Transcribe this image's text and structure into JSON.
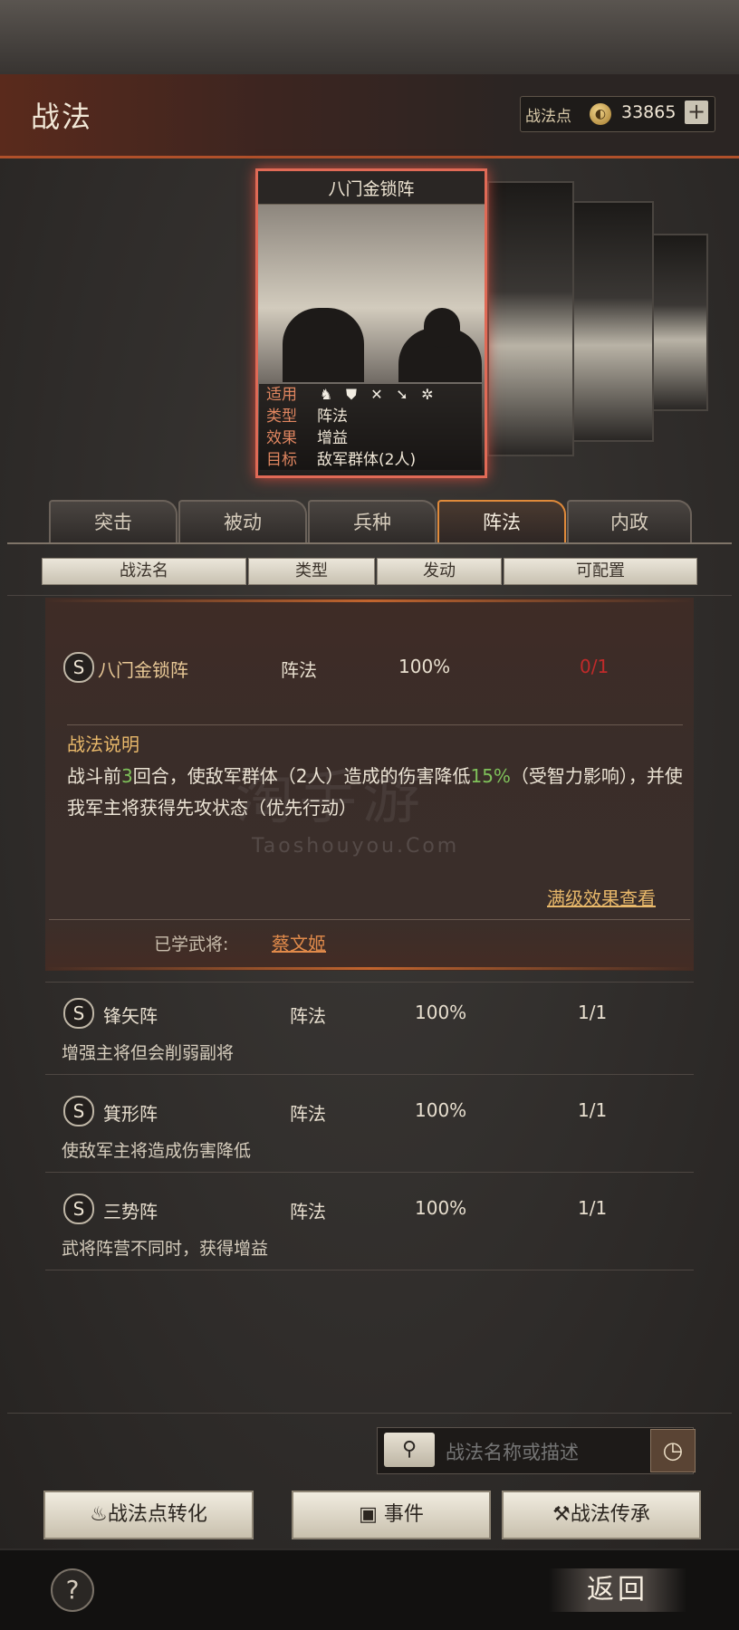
{
  "header": {
    "title": "战法",
    "points_label": "战法点",
    "points_value": "33865",
    "add_symbol": "+"
  },
  "card": {
    "title": "八门金锁阵",
    "rows": [
      {
        "key": "适用",
        "value": ""
      },
      {
        "key": "类型",
        "value": "阵法"
      },
      {
        "key": "效果",
        "value": "增益"
      },
      {
        "key": "目标",
        "value": "敌军群体(2人)"
      }
    ],
    "troop_icons": [
      "cavalry-icon",
      "shield-icon",
      "bow-icon",
      "spear-icon",
      "wheel-icon"
    ]
  },
  "tabs": [
    {
      "label": "突击",
      "active": false
    },
    {
      "label": "被动",
      "active": false
    },
    {
      "label": "兵种",
      "active": false
    },
    {
      "label": "阵法",
      "active": true
    },
    {
      "label": "内政",
      "active": false
    }
  ],
  "columns": [
    "战法名",
    "类型",
    "发动",
    "可配置"
  ],
  "expanded": {
    "grade": "S",
    "name": "八门金锁阵",
    "type": "阵法",
    "rate": "100%",
    "config": "0/1",
    "desc_heading": "战法说明",
    "desc_parts": [
      "战斗前",
      "3",
      "回合，使敌军群体（2人）造成的伤害降低",
      "15%",
      "（受智力影响），并使我军主将获得先攻状态（优先行动）"
    ],
    "watermark": "淘手游",
    "watermark_sub": "Taoshouyou.Com",
    "full_effect_link": "满级效果查看",
    "learned_label": "已学武将:",
    "learned_name": "蔡文姬"
  },
  "list": [
    {
      "grade": "S",
      "name": "锋矢阵",
      "type": "阵法",
      "rate": "100%",
      "config": "1/1",
      "desc": "增强主将但会削弱副将"
    },
    {
      "grade": "S",
      "name": "箕形阵",
      "type": "阵法",
      "rate": "100%",
      "config": "1/1",
      "desc": "使敌军主将造成伤害降低"
    },
    {
      "grade": "S",
      "name": "三势阵",
      "type": "阵法",
      "rate": "100%",
      "config": "1/1",
      "desc": "武将阵营不同时，获得增益"
    }
  ],
  "search": {
    "placeholder": "战法名称或描述"
  },
  "actions": {
    "convert": "战法点转化",
    "events": "事件",
    "inherit": "战法传承"
  },
  "footer": {
    "help": "?",
    "back": "返回"
  },
  "colors": {
    "accent": "#e08a3a",
    "config_full": "#c02a2a",
    "highlight": "#7fc15a",
    "link": "#e8b86a"
  }
}
